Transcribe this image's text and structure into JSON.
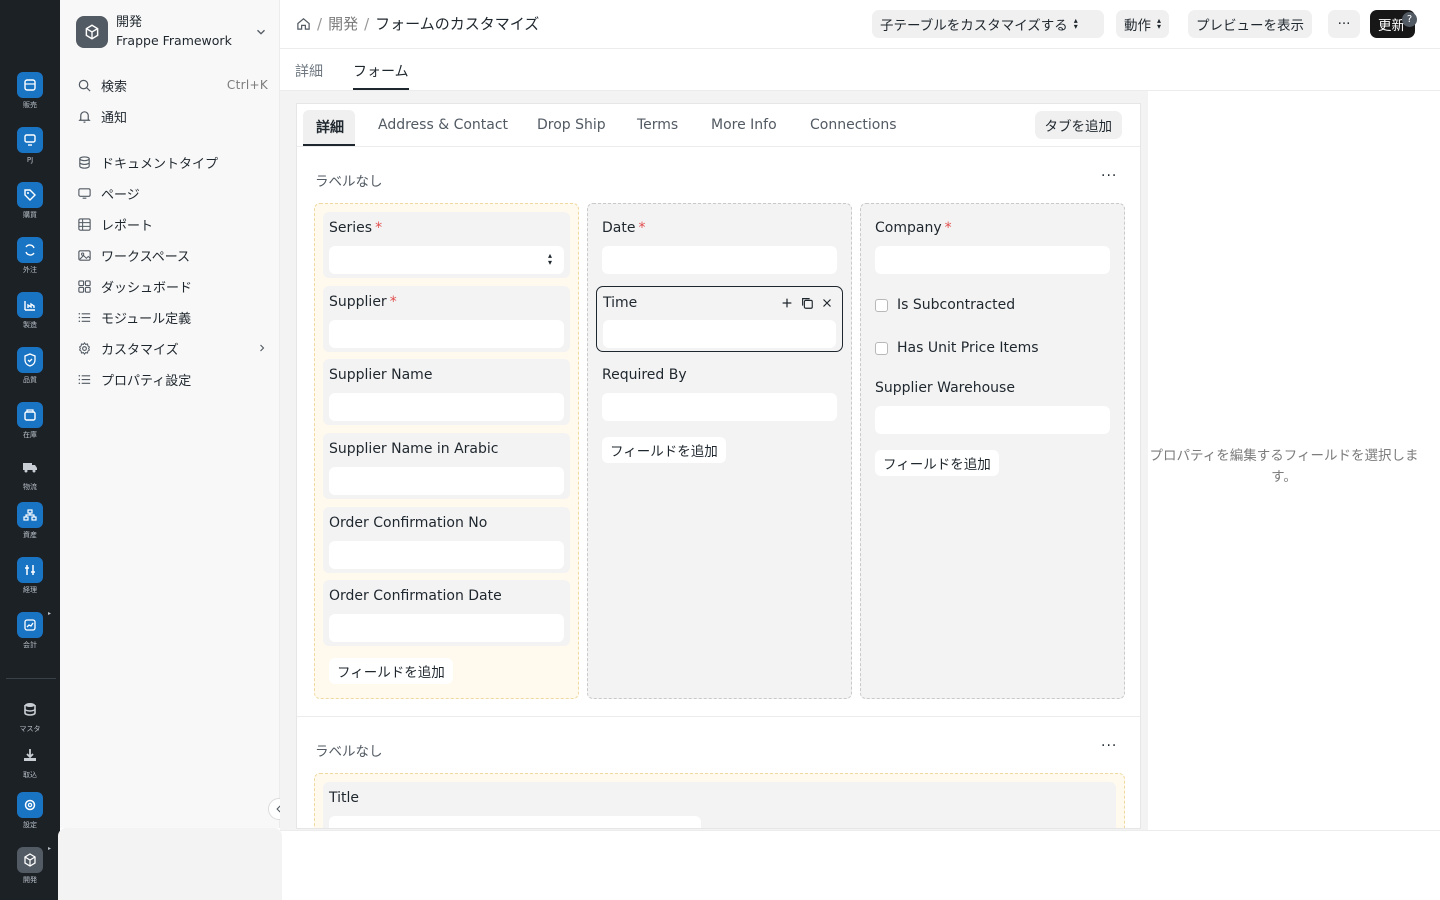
{
  "rail": {
    "items": [
      {
        "label": "販売",
        "icon": "sales-icon"
      },
      {
        "label": "PJ",
        "icon": "project-icon"
      },
      {
        "label": "購買",
        "icon": "buying-icon"
      },
      {
        "label": "外注",
        "icon": "subcontract-icon"
      },
      {
        "label": "製造",
        "icon": "manufacturing-icon"
      },
      {
        "label": "品質",
        "icon": "quality-icon"
      },
      {
        "label": "在庫",
        "icon": "stock-icon"
      },
      {
        "label": "物流",
        "icon": "truck-icon"
      },
      {
        "label": "資産",
        "icon": "assets-icon"
      },
      {
        "label": "経理",
        "icon": "accounting-icon"
      },
      {
        "label": "会計",
        "icon": "finance-icon"
      },
      {
        "label": "マスタ",
        "icon": "database-icon"
      },
      {
        "label": "取込",
        "icon": "import-icon"
      },
      {
        "label": "設定",
        "icon": "settings-icon"
      },
      {
        "label": "開発",
        "icon": "develop-icon"
      }
    ],
    "accent": "#1a74c4"
  },
  "workspace": {
    "title": "開発",
    "subtitle": "Frappe Framework"
  },
  "sidebar": {
    "search_label": "検索",
    "search_shortcut": "Ctrl+K",
    "notifications_label": "通知",
    "items": [
      {
        "label": "ドキュメントタイプ",
        "icon": "database-icon"
      },
      {
        "label": "ページ",
        "icon": "monitor-icon"
      },
      {
        "label": "レポート",
        "icon": "table-icon"
      },
      {
        "label": "ワークスペース",
        "icon": "image-icon"
      },
      {
        "label": "ダッシュボード",
        "icon": "grid-icon"
      },
      {
        "label": "モジュール定義",
        "icon": "list-icon"
      },
      {
        "label": "カスタマイズ",
        "icon": "gear-icon"
      },
      {
        "label": "プロパティ設定",
        "icon": "list-icon"
      }
    ]
  },
  "breadcrumb": {
    "parent": "開発",
    "current": "フォームのカスタマイズ"
  },
  "toolbar": {
    "customize_child": "子テーブルをカスタマイズする",
    "actions": "動作",
    "preview": "プレビューを表示",
    "more": "···",
    "update": "更新"
  },
  "page_tabs": {
    "details": "詳細",
    "form": "フォーム"
  },
  "form_tabs": {
    "tabs": [
      "詳細",
      "Address & Contact",
      "Drop Ship",
      "Terms",
      "More Info",
      "Connections"
    ],
    "add_tab": "タブを追加"
  },
  "sections": [
    {
      "label": "ラベルなし",
      "menu": "···",
      "columns": [
        {
          "fields": [
            {
              "label": "Series",
              "required": "*"
            },
            {
              "label": "Supplier",
              "required": "*"
            },
            {
              "label": "Supplier Name"
            },
            {
              "label": "Supplier Name in Arabic"
            },
            {
              "label": "Order Confirmation No"
            },
            {
              "label": "Order Confirmation Date"
            }
          ],
          "add_field": "フィールドを追加"
        },
        {
          "fields": [
            {
              "label": "Date",
              "required": "*"
            },
            {
              "label": "Time"
            },
            {
              "label": "Required By"
            }
          ],
          "add_field": "フィールドを追加"
        },
        {
          "fields": [
            {
              "label": "Company",
              "required": "*"
            },
            {
              "label": "Is Subcontracted"
            },
            {
              "label": "Has Unit Price Items"
            },
            {
              "label": "Supplier Warehouse"
            }
          ],
          "add_field": "フィールドを追加"
        }
      ]
    },
    {
      "label": "ラベルなし",
      "menu": "···",
      "columns": [
        {
          "fields": [
            {
              "label": "Title"
            }
          ]
        }
      ]
    }
  ],
  "properties_panel": {
    "empty_text": "プロパティを編集するフィールドを選択します。"
  }
}
